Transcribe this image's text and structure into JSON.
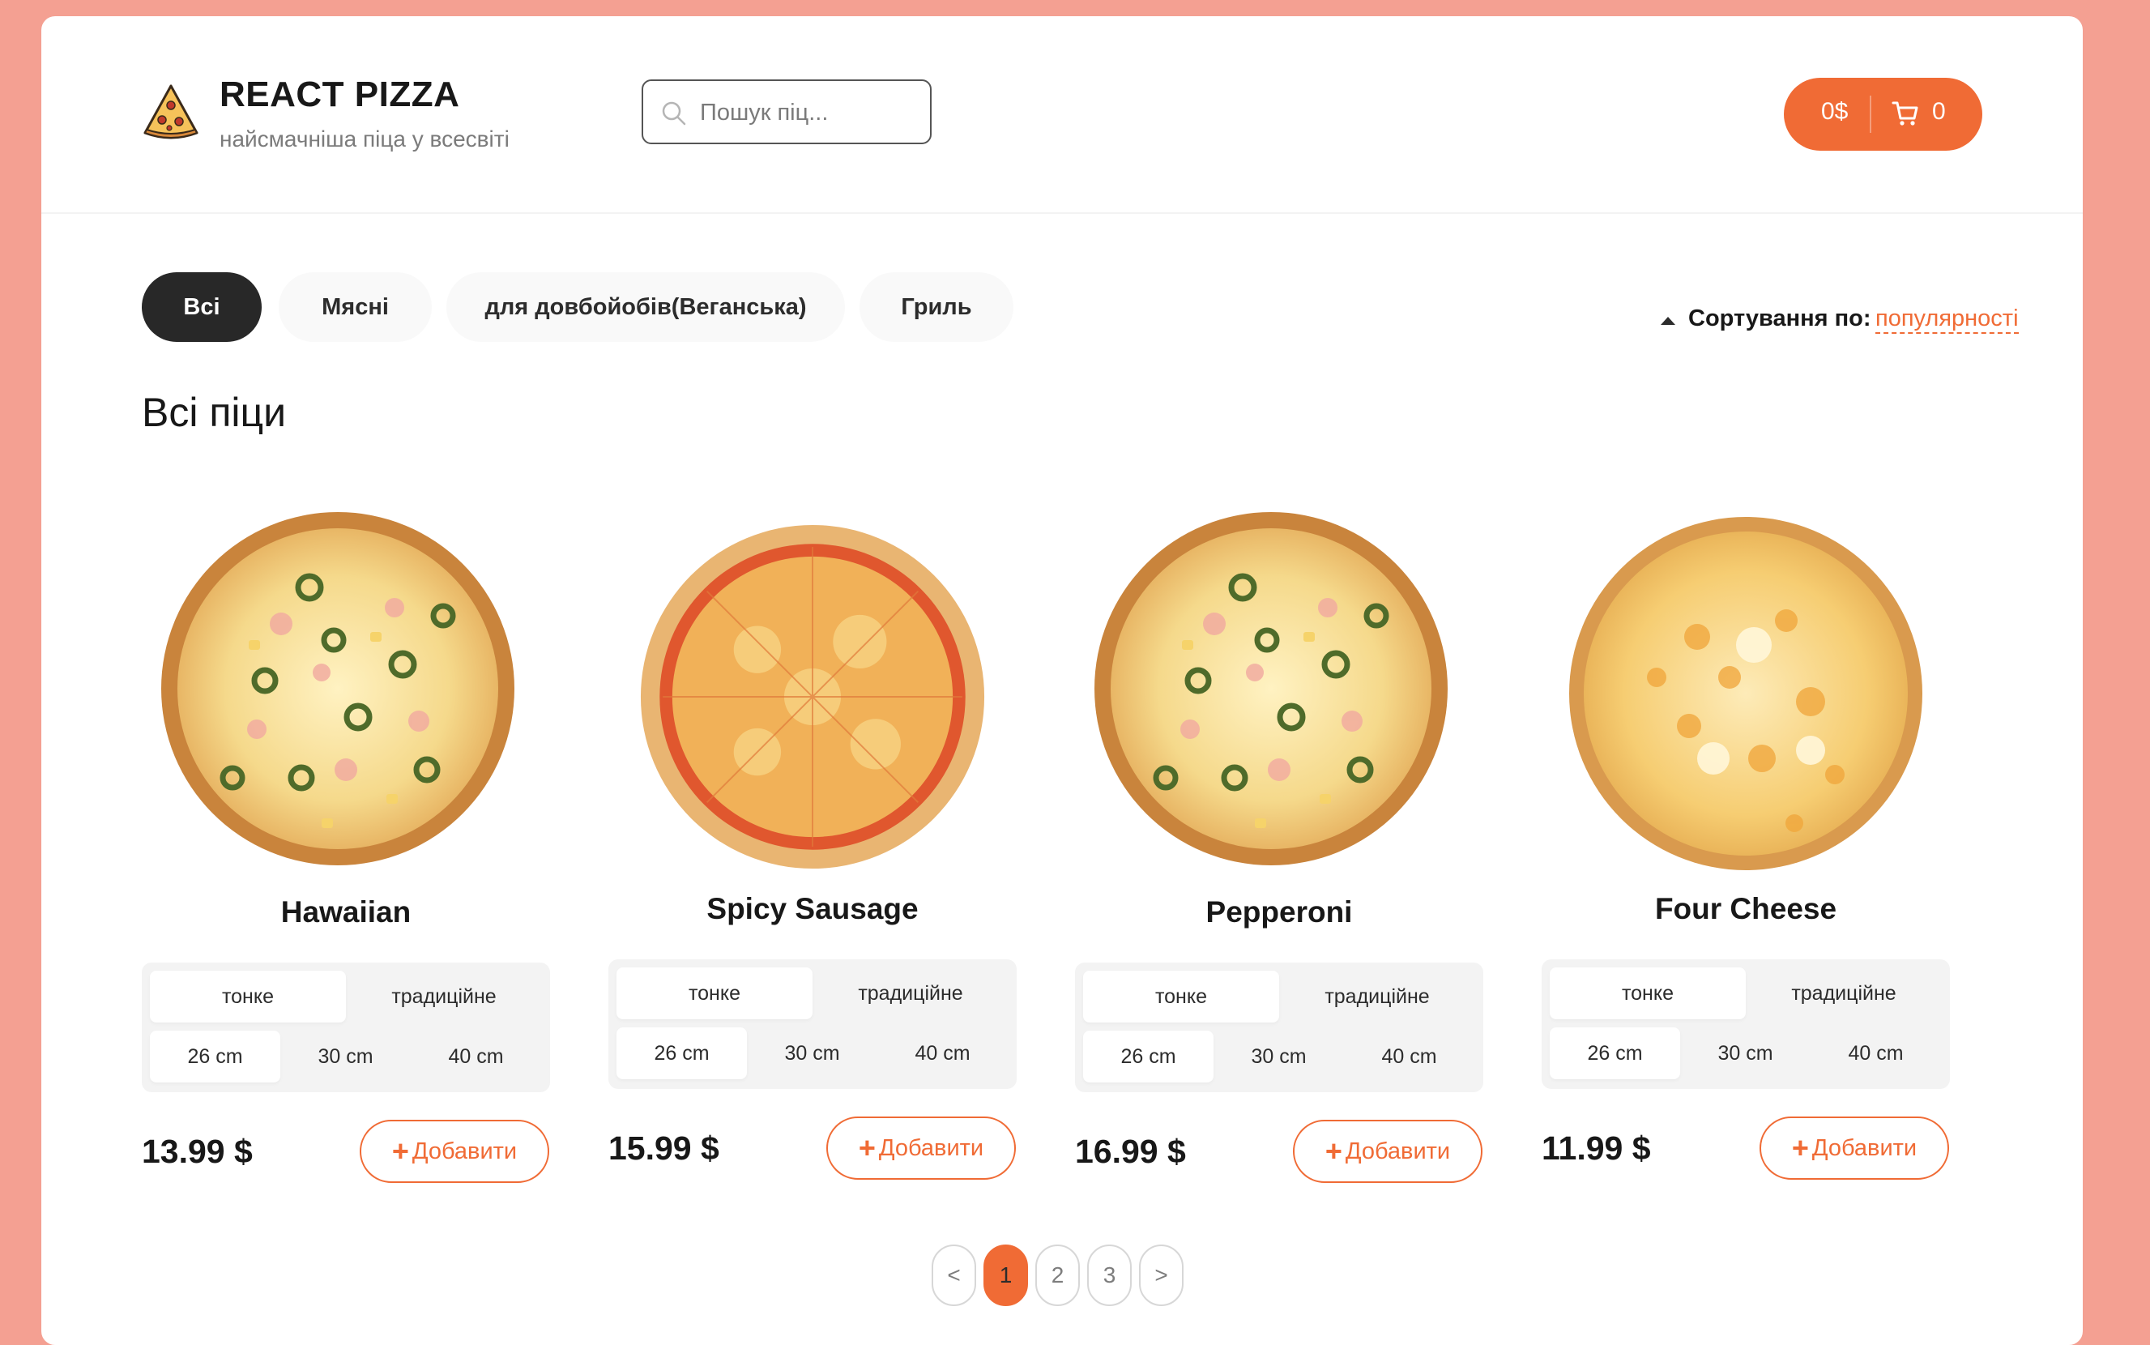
{
  "header": {
    "brand_title": "REACT PIZZA",
    "brand_subtitle": "найсмачніша піца у всесвіті",
    "search_placeholder": "Пошук піц...",
    "cart_total": "0$",
    "cart_count": "0",
    "logo_icon": "pizza-slice-icon",
    "search_icon": "search-icon",
    "cart_icon": "cart-icon"
  },
  "categories": [
    {
      "label": "Всі",
      "active": true
    },
    {
      "label": "Мясні",
      "active": false
    },
    {
      "label": "для довбойобів(Веганська)",
      "active": false
    },
    {
      "label": "Гриль",
      "active": false
    }
  ],
  "sort": {
    "label": "Сортування по:",
    "value": "популярності"
  },
  "page_title": "Всі піци",
  "pizzas": [
    {
      "name": "Hawaiian",
      "doughs": [
        "тонке",
        "традиційне"
      ],
      "active_dough": 0,
      "sizes": [
        "26 cm",
        "30 cm",
        "40 cm"
      ],
      "active_size": 0,
      "price": "13.99 $",
      "add_label": "Добавити"
    },
    {
      "name": "Spicy Sausage",
      "doughs": [
        "тонке",
        "традиційне"
      ],
      "active_dough": 0,
      "sizes": [
        "26 cm",
        "30 cm",
        "40 cm"
      ],
      "active_size": 0,
      "price": "15.99 $",
      "add_label": "Добавити"
    },
    {
      "name": "Pepperoni",
      "doughs": [
        "тонке",
        "традиційне"
      ],
      "active_dough": 0,
      "sizes": [
        "26 cm",
        "30 cm",
        "40 cm"
      ],
      "active_size": 0,
      "price": "16.99 $",
      "add_label": "Добавити"
    },
    {
      "name": "Four Cheese",
      "doughs": [
        "тонке",
        "традиційне"
      ],
      "active_dough": 0,
      "sizes": [
        "26 cm",
        "30 cm",
        "40 cm"
      ],
      "active_size": 0,
      "price": "11.99 $",
      "add_label": "Добавити"
    }
  ],
  "pagination": {
    "prev": "<",
    "pages": [
      "1",
      "2",
      "3"
    ],
    "current": "1",
    "next": ">"
  },
  "colors": {
    "accent": "#f06b35",
    "page_background": "#f4a092",
    "active_category": "#282828"
  }
}
